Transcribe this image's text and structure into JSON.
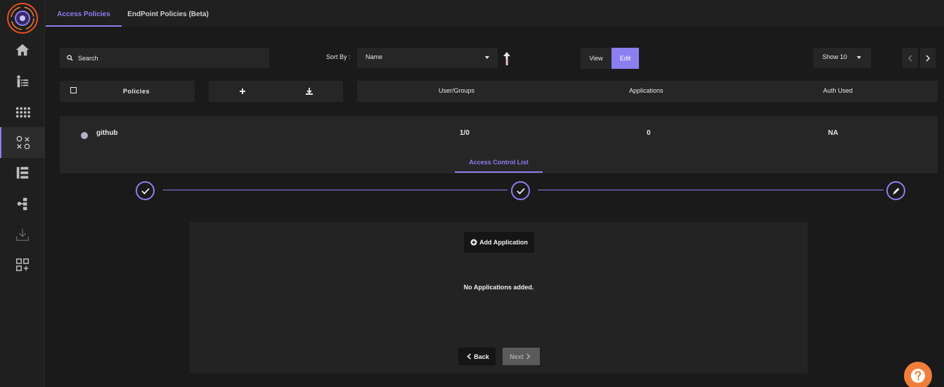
{
  "tabs": [
    {
      "label": "Access Policies",
      "active": true
    },
    {
      "label": "EndPoint Policies (Beta)",
      "active": false
    }
  ],
  "toolbar": {
    "search_placeholder": "Search",
    "sort_by_label": "Sort By :",
    "sort_value": "Name",
    "view_label": "View",
    "edit_label": "Edit",
    "show_value": "Show 10"
  },
  "table": {
    "policies_header": "Policies",
    "columns": [
      "User/Groups",
      "Applications",
      "Auth Used"
    ]
  },
  "policy": {
    "name": "github",
    "user_groups": "1/0",
    "applications": "0",
    "auth_used": "NA",
    "subtab_label": "Access Control List"
  },
  "panel": {
    "add_application_label": "Add Application",
    "empty_message": "No Applications added.",
    "back_label": "Back",
    "next_label": "Next"
  },
  "colors": {
    "accent": "#8b7ff0",
    "help": "#f07e3a"
  }
}
